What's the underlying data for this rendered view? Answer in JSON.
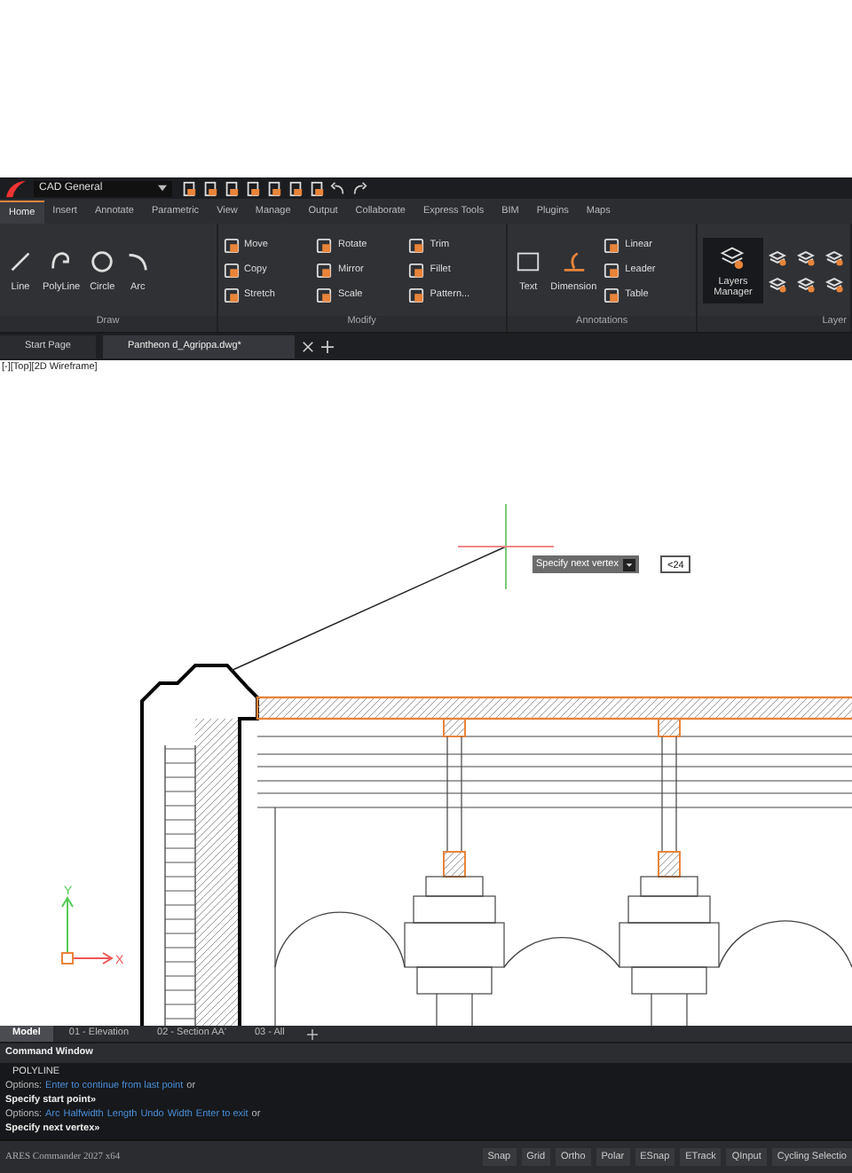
{
  "quick_access": {
    "workspace": "CAD General"
  },
  "ribbon_tabs": [
    {
      "label": "Home",
      "selected": true
    },
    {
      "label": "Insert",
      "selected": false
    },
    {
      "label": "Annotate",
      "selected": false
    },
    {
      "label": "Parametric",
      "selected": false
    },
    {
      "label": "View",
      "selected": false
    },
    {
      "label": "Manage",
      "selected": false
    },
    {
      "label": "Output",
      "selected": false
    },
    {
      "label": "Collaborate",
      "selected": false
    },
    {
      "label": "Express Tools",
      "selected": false
    },
    {
      "label": "BIM",
      "selected": false
    },
    {
      "label": "Plugins",
      "selected": false
    },
    {
      "label": "Maps",
      "selected": false
    }
  ],
  "ribbon_panels": [
    {
      "title": "Draw",
      "large": [
        {
          "label": "Line",
          "kind": "line"
        },
        {
          "label": "PolyLine",
          "kind": "polyline"
        },
        {
          "label": "Circle",
          "kind": "circle"
        },
        {
          "label": "Arc",
          "kind": "arc"
        }
      ]
    },
    {
      "title": "Modify",
      "small": [
        {
          "label": "Move"
        },
        {
          "label": "Copy"
        },
        {
          "label": "Stretch"
        },
        {
          "label": "Rotate"
        },
        {
          "label": "Mirror"
        },
        {
          "label": "Scale"
        },
        {
          "label": "Trim"
        },
        {
          "label": "Fillet"
        },
        {
          "label": "Pattern..."
        }
      ]
    },
    {
      "title": "Annotations",
      "large": [
        {
          "label": "Text",
          "kind": "text"
        },
        {
          "label": "Dimension",
          "kind": "dimension"
        }
      ],
      "small": [
        {
          "label": "Linear"
        },
        {
          "label": "Leader"
        },
        {
          "label": "Table"
        }
      ]
    },
    {
      "title": "Layer",
      "large": [
        {
          "label": "Layers Manager",
          "kind": "layers"
        }
      ]
    }
  ],
  "document_tabs": [
    {
      "label": "Start Page",
      "selected": false
    },
    {
      "label": "Pantheon d_Agrippa.dwg*",
      "selected": true
    }
  ],
  "viewport": {
    "label": "[-][Top][2D Wireframe]",
    "tooltip": "Specify next vertex",
    "input": "<24",
    "ucs_y": "Y",
    "ucs_x": "X"
  },
  "layout_tabs": [
    {
      "label": "Model",
      "selected": true
    },
    {
      "label": "01 - Elevation",
      "selected": false
    },
    {
      "label": "02 - Section AA'",
      "selected": false
    },
    {
      "label": "03 - All",
      "selected": false
    }
  ],
  "command_window": {
    "title": "Command Window",
    "lines": [
      {
        "kind": "echo",
        "text": "POLYLINE"
      },
      {
        "kind": "options",
        "label": "Options:",
        "options": [
          "Enter to continue from last point"
        ],
        "suffix": "or"
      },
      {
        "kind": "prompt",
        "text": "Specify start point»"
      },
      {
        "kind": "options",
        "label": "Options:",
        "options": [
          "Arc",
          "Halfwidth",
          "Length",
          "Undo",
          "Width",
          "Enter to exit"
        ],
        "suffix": "or"
      },
      {
        "kind": "prompt",
        "text": "Specify next vertex»"
      }
    ]
  },
  "status_bar": {
    "app": "ARES Commander 2027 x64",
    "buttons": [
      "Snap",
      "Grid",
      "Ortho",
      "Polar",
      "ESnap",
      "ETrack",
      "QInput",
      "Cycling Selectio"
    ]
  }
}
